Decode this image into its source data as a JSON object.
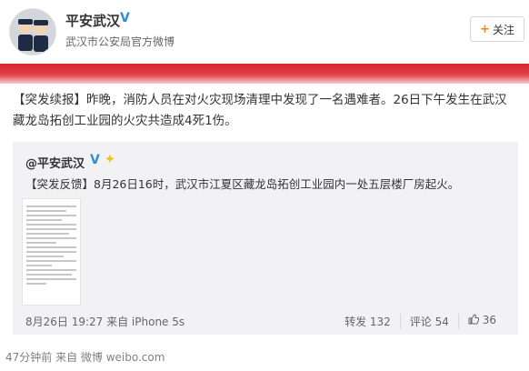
{
  "header": {
    "user_name": "平安武汉",
    "verified_mark": "V",
    "user_desc": "武汉市公安局官方微博",
    "follow_label": "关注",
    "follow_plus": "+"
  },
  "post": {
    "tag": "【突发续报】",
    "text": "昨晚，消防人员在对火灾现场清理中发现了一名遇难者。26日下午发生在武汉藏龙岛拓创工业园的火灾共造成4死1伤。"
  },
  "repost": {
    "user": "@平安武汉",
    "text": "【突发反馈】8月26日16时，武汉市江夏区藏龙岛拓创工业园内一处五层楼厂房起火。",
    "meta": "8月26日 19:27 来自 iPhone 5s",
    "forward_label": "转发 132",
    "comment_label": "评论 54",
    "like_count": "36"
  },
  "footer": {
    "meta": "47分钟前 来自 微博 weibo.com"
  },
  "colors": {
    "accent": "#ff8200",
    "verified": "#2e8fd8",
    "banner_red": "#d6262d"
  }
}
